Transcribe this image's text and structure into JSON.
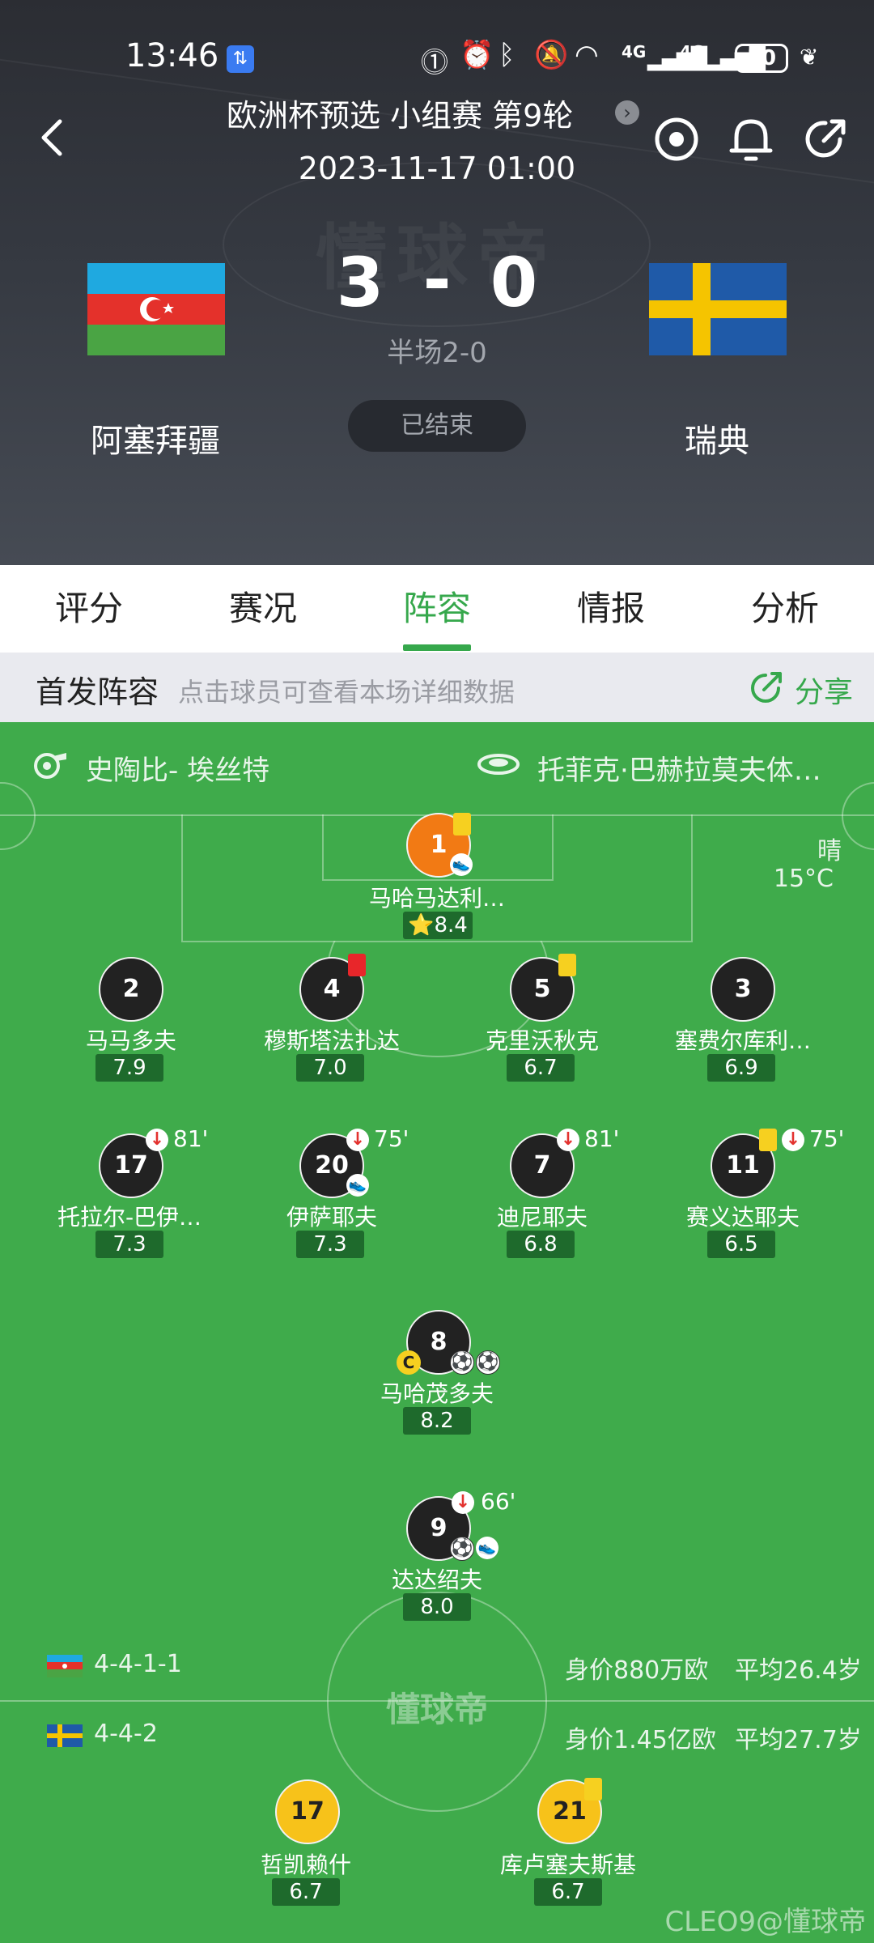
{
  "status_bar": {
    "time": "13:46",
    "network_1": "4G",
    "network_2": "4G",
    "battery": "30"
  },
  "header": {
    "competition": "欧洲杯预选 小组赛 第9轮",
    "datetime": "2023-11-17 01:00",
    "home_team": "阿塞拜疆",
    "away_team": "瑞典",
    "home_score": "3",
    "away_score": "0",
    "score_sep": "-",
    "halftime": "半场2-0",
    "status": "已结束",
    "watermark": "懂球帝"
  },
  "tabs": [
    "评分",
    "赛况",
    "阵容",
    "情报",
    "分析"
  ],
  "active_tab": 2,
  "lineup_header": {
    "title": "首发阵容",
    "hint": "点击球员可查看本场详细数据",
    "share": "分享"
  },
  "pitch_info": {
    "referee": "史陶比- 埃丝特",
    "stadium": "托菲克·巴赫拉莫夫体…",
    "weather": "晴",
    "temperature": "15°C",
    "center_logo": "懂球帝"
  },
  "home_team_info": {
    "formation": "4-4-1-1",
    "value": "身价880万欧",
    "avg_age": "平均26.4岁"
  },
  "away_team_info": {
    "formation": "4-4-2",
    "value": "身价1.45亿欧",
    "avg_age": "平均27.7岁"
  },
  "home_players": [
    {
      "number": "1",
      "name": "马哈马达利…",
      "rating": "8.4"
    },
    {
      "number": "2",
      "name": "马马多夫",
      "rating": "7.9"
    },
    {
      "number": "4",
      "name": "穆斯塔法扎达",
      "rating": "7.0"
    },
    {
      "number": "5",
      "name": "克里沃秋克",
      "rating": "6.7"
    },
    {
      "number": "3",
      "name": "塞费尔库利…",
      "rating": "6.9"
    },
    {
      "number": "17",
      "name": "托拉尔-巴伊…",
      "rating": "7.3",
      "sub": "81'"
    },
    {
      "number": "20",
      "name": "伊萨耶夫",
      "rating": "7.3",
      "sub": "75'"
    },
    {
      "number": "7",
      "name": "迪尼耶夫",
      "rating": "6.8",
      "sub": "81'"
    },
    {
      "number": "11",
      "name": "赛义达耶夫",
      "rating": "6.5",
      "sub": "75'"
    },
    {
      "number": "8",
      "name": "马哈茂多夫",
      "rating": "8.2",
      "captain": "C"
    },
    {
      "number": "9",
      "name": "达达绍夫",
      "rating": "8.0",
      "sub": "66'"
    }
  ],
  "away_players": [
    {
      "number": "17",
      "name": "哲凯赖什",
      "rating": "6.7"
    },
    {
      "number": "21",
      "name": "库卢塞夫斯基",
      "rating": "6.7"
    }
  ],
  "watermark_footer": "CLEO9@懂球帝",
  "colors": {
    "accent": "#36a84c",
    "pitch": "#3fab4b",
    "rating_bg": "#1e6a2c",
    "home_circle": "#222222",
    "motm_circle": "#f27a14",
    "away_circle": "#f7c21a",
    "yellow_card": "#f6d020",
    "red_card": "#e8262a"
  }
}
